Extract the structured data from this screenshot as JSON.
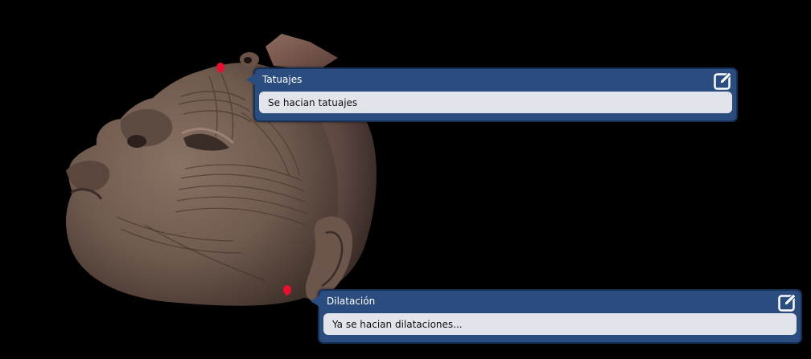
{
  "viewer": {
    "background": "#000000"
  },
  "annotations": [
    {
      "title": "Tatuajes",
      "text": "Se hacian tatuajes",
      "edit_icon": "edit-icon"
    },
    {
      "title": "Dilatación",
      "text": "Ya se hacian dilataciones...",
      "edit_icon": "edit-icon"
    }
  ],
  "colors": {
    "annotation_header": "#2b4c7f",
    "annotation_border": "#173056",
    "annotation_body": "#e1e4ea",
    "hotspot": "#e8102e"
  }
}
